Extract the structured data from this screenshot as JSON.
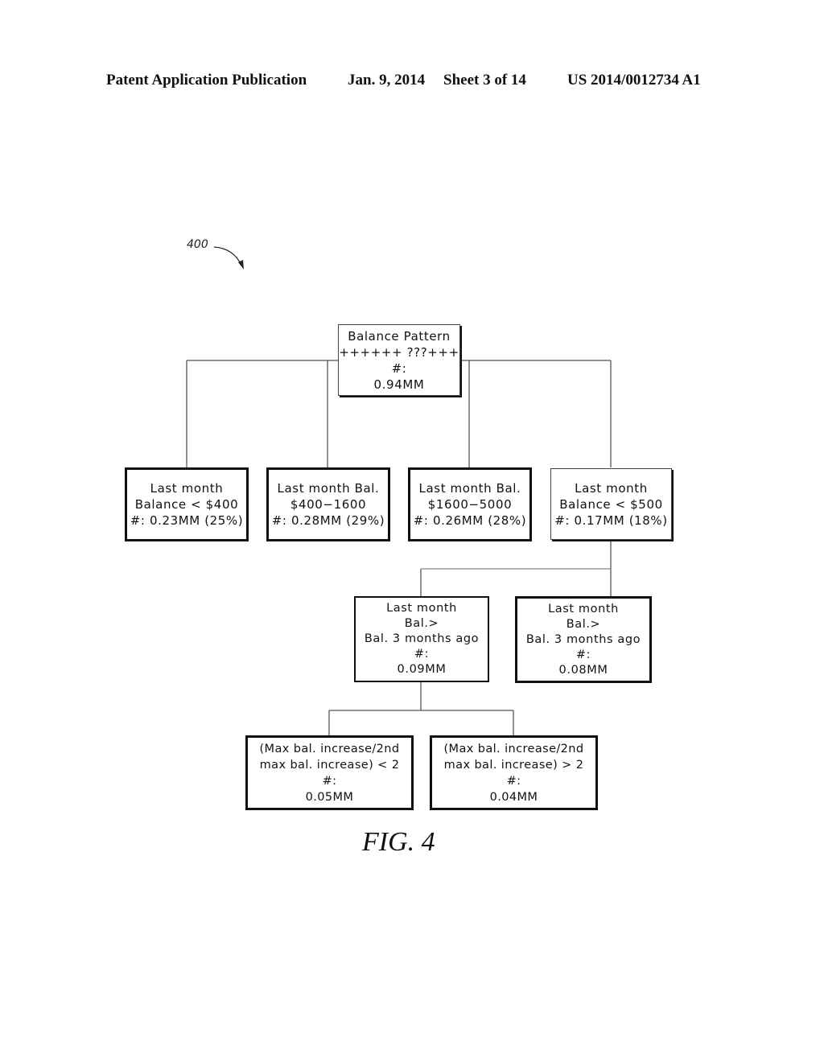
{
  "header": {
    "publication": "Patent Application Publication",
    "date": "Jan. 9, 2014",
    "sheet": "Sheet 3 of 14",
    "number": "US 2014/0012734 A1"
  },
  "reference_numeral": "400",
  "figure_label": "FIG. 4",
  "tree": {
    "root": {
      "lines": [
        "Balance Pattern",
        "++++++ ???+++",
        "#:",
        "0.94MM"
      ]
    },
    "level1": [
      {
        "lines": [
          "Last month",
          "Balance < $400",
          "#: 0.23MM (25%)"
        ]
      },
      {
        "lines": [
          "Last month Bal.",
          "$400−1600",
          "#: 0.28MM (29%)"
        ]
      },
      {
        "lines": [
          "Last month Bal.",
          "$1600−5000",
          "#: 0.26MM (28%)"
        ]
      },
      {
        "lines": [
          "Last month",
          "Balance < $500",
          "#: 0.17MM (18%)"
        ]
      }
    ],
    "level2": [
      {
        "lines": [
          "Last month",
          "Bal.>",
          "Bal. 3 months ago",
          "#:",
          "0.09MM"
        ]
      },
      {
        "lines": [
          "Last month",
          "Bal.>",
          "Bal. 3 months ago",
          "#:",
          "0.08MM"
        ]
      }
    ],
    "level3": [
      {
        "lines": [
          "(Max bal. increase/2nd",
          "max bal. increase) < 2",
          "#:",
          "0.05MM"
        ]
      },
      {
        "lines": [
          "(Max bal. increase/2nd",
          "max bal. increase) > 2",
          "#:",
          "0.04MM"
        ]
      }
    ]
  }
}
